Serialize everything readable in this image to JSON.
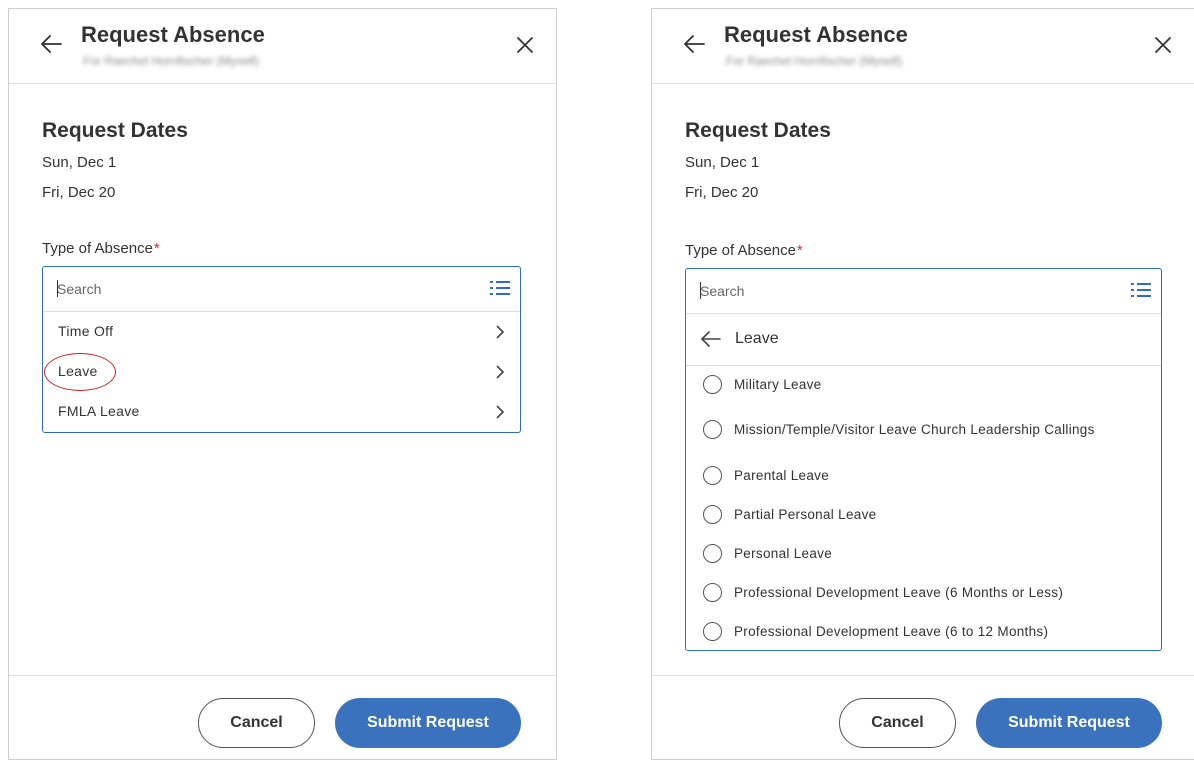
{
  "left_panel": {
    "title": "Request Absence",
    "subtitle": "For Raechel Hornfischer (Myself)",
    "section_title": "Request Dates",
    "start_date": "Sun, Dec 1",
    "end_date": "Fri, Dec 20",
    "field_label": "Type of Absence",
    "required_mark": "*",
    "search_placeholder": "Search",
    "options": [
      {
        "label": "Time Off"
      },
      {
        "label": "Leave",
        "highlighted": true
      },
      {
        "label": "FMLA Leave"
      }
    ],
    "cancel_label": "Cancel",
    "submit_label": "Submit Request"
  },
  "right_panel": {
    "title": "Request Absence",
    "subtitle": "For Raechel Hornfischer (Myself)",
    "section_title": "Request Dates",
    "start_date": "Sun, Dec 1",
    "end_date": "Fri, Dec 20",
    "field_label": "Type of Absence",
    "required_mark": "*",
    "search_placeholder": "Search",
    "category_label": "Leave",
    "options": [
      {
        "label": "Military Leave"
      },
      {
        "label": "Mission/Temple/Visitor Leave Church Leadership Callings"
      },
      {
        "label": "Parental Leave"
      },
      {
        "label": "Partial Personal Leave"
      },
      {
        "label": "Personal Leave"
      },
      {
        "label": "Professional Development Leave (6 Months or Less)"
      },
      {
        "label": "Professional Development Leave (6 to 12 Months)"
      }
    ],
    "cancel_label": "Cancel",
    "submit_label": "Submit Request"
  },
  "colors": {
    "accent": "#3a72be",
    "dropdown_border": "#2f6fb7",
    "required": "#d32f2f",
    "highlight_ring": "#cc2222"
  },
  "icons": [
    "back-arrow-icon",
    "close-icon",
    "list-icon",
    "chevron-right-icon",
    "radio-button-icon"
  ]
}
